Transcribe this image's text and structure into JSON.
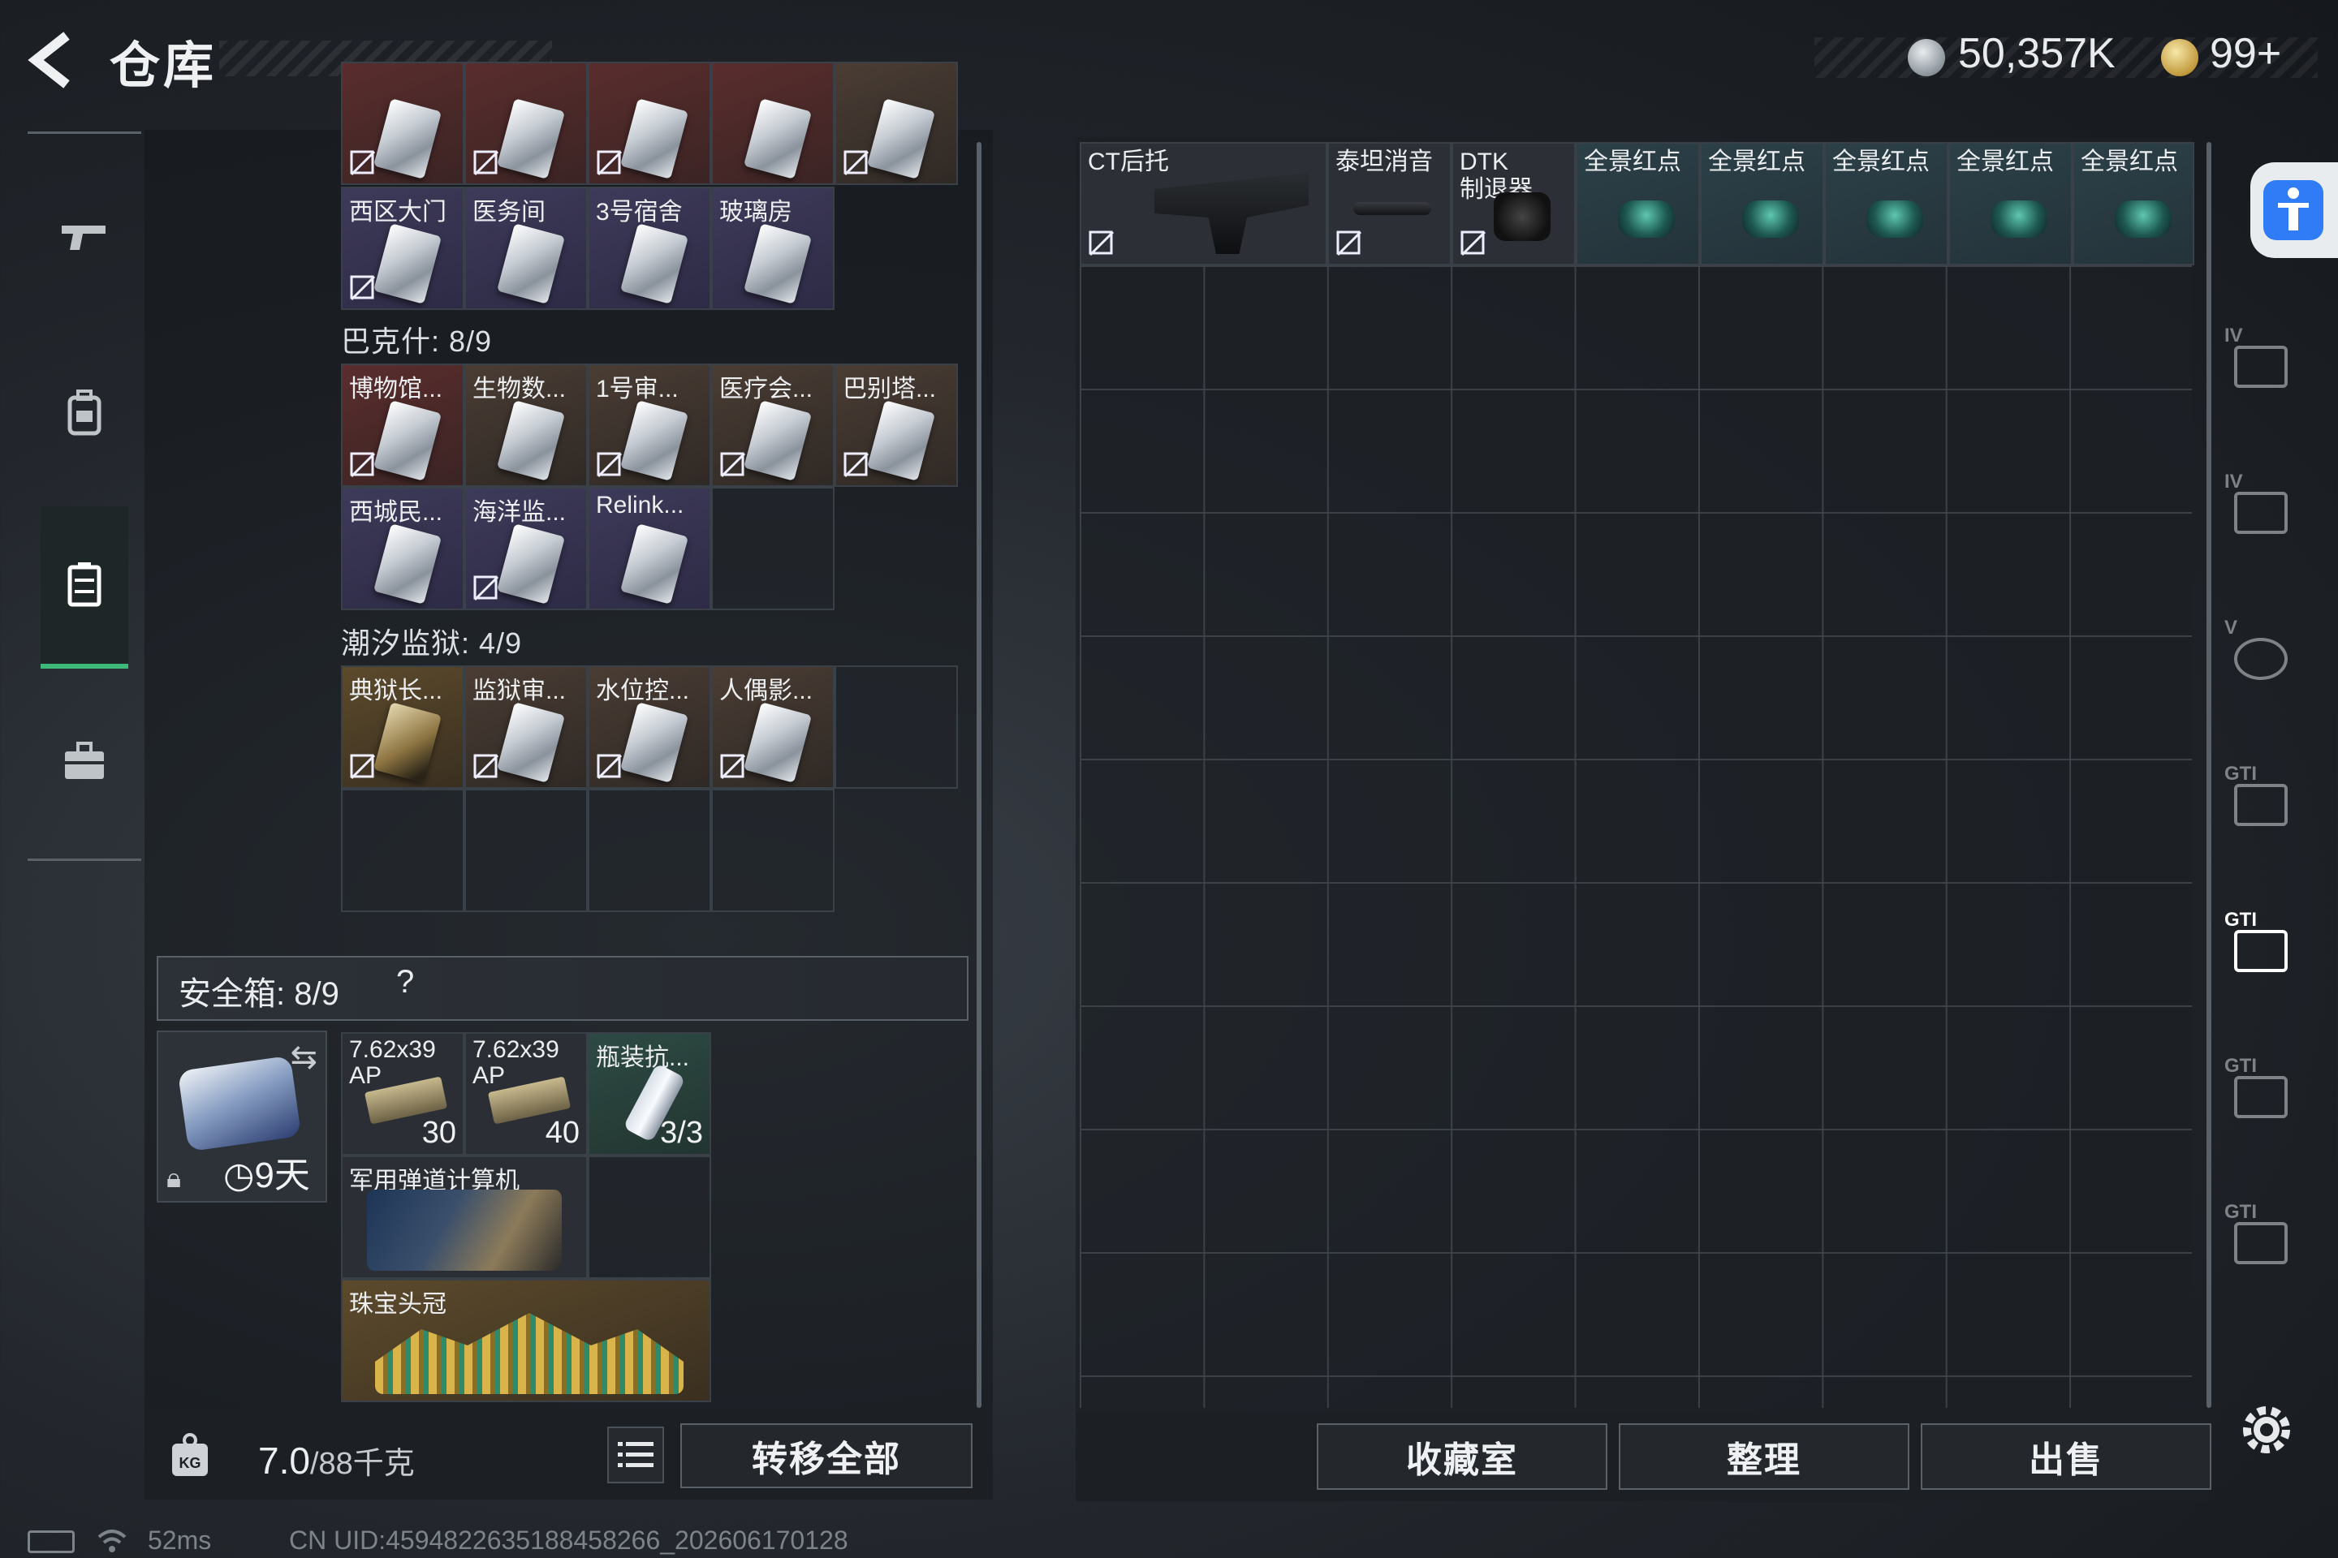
{
  "header": {
    "title": "仓库",
    "currency_silver": "50,357K",
    "currency_gold": "99+"
  },
  "left_nav": {
    "items": [
      {
        "icon": "pistol-icon",
        "active": false
      },
      {
        "icon": "backpack-icon",
        "active": false
      },
      {
        "icon": "locker-icon",
        "active": true
      },
      {
        "icon": "toolbox-icon",
        "active": false
      }
    ]
  },
  "storage": {
    "top_cards_row1": [
      "",
      "",
      "",
      "",
      ""
    ],
    "top_cards_row2": [
      "西区大门",
      "医务间",
      "3号宿舍",
      "玻璃房"
    ],
    "section_bakeshi": "巴克什: 8/9",
    "bakeshi_row1": [
      "博物馆...",
      "生物数...",
      "1号审...",
      "医疗会...",
      "巴别塔..."
    ],
    "bakeshi_row2": [
      "西城民...",
      "海洋监...",
      "Relink..."
    ],
    "section_chaoxi": "潮汐监狱: 4/9",
    "chaoxi_row1": [
      "典狱长...",
      "监狱审...",
      "水位控...",
      "人偶影..."
    ]
  },
  "safe_box": {
    "title": "安全箱: 8/9",
    "help": "?",
    "days": "9天",
    "items": [
      {
        "name": "7.62x39\nAP",
        "count": "30"
      },
      {
        "name": "7.62x39\nAP",
        "count": "40"
      },
      {
        "name": "瓶装抗...",
        "count": "3/3"
      }
    ],
    "computer_name": "军用弹道计算机",
    "crown_name": "珠宝头冠"
  },
  "left_bottom": {
    "weight_value": "7.0",
    "weight_max": "/88千克",
    "kg_label": "KG",
    "transfer_all": "转移全部"
  },
  "right_items": [
    {
      "name": "CT后托",
      "kind": "stock"
    },
    {
      "name": "泰坦消音",
      "kind": "silencer"
    },
    {
      "name": "DTK\n制退器",
      "kind": "brake"
    },
    {
      "name": "全景红点",
      "kind": "scope"
    },
    {
      "name": "全景红点",
      "kind": "scope"
    },
    {
      "name": "全景红点",
      "kind": "scope"
    },
    {
      "name": "全景红点",
      "kind": "scope"
    },
    {
      "name": "全景红点",
      "kind": "scope"
    }
  ],
  "right_bottom": {
    "collection": "收藏室",
    "arrange": "整理",
    "sell": "出售"
  },
  "right_rail": [
    {
      "label": "IV",
      "icon": "folder-iv-icon"
    },
    {
      "label": "IV",
      "icon": "folder-iv-icon"
    },
    {
      "label": "V",
      "icon": "safe-v-icon"
    },
    {
      "label": "GTI",
      "icon": "case-gti-icon"
    },
    {
      "label": "GTI",
      "icon": "rack-gti-icon",
      "active": true
    },
    {
      "label": "GTI",
      "icon": "case-gti-icon"
    },
    {
      "label": "GTI",
      "icon": "case-gti-icon"
    }
  ],
  "status_bar": {
    "ping": "52ms",
    "uid": "CN UID:4594822635188458266_202606170128"
  }
}
